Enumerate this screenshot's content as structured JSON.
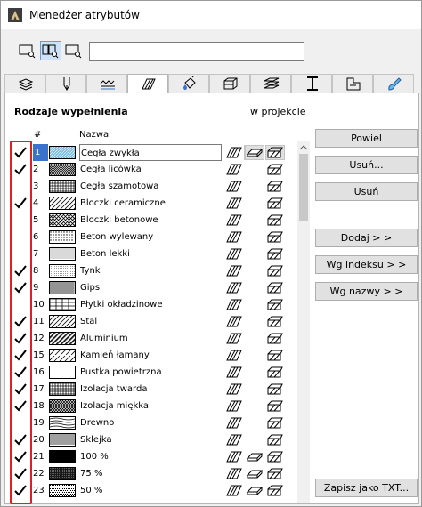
{
  "window": {
    "title": "Menedżer atrybutów"
  },
  "toolbar": {
    "buttons": [
      {
        "name": "view-list-icon"
      },
      {
        "name": "view-details-icon"
      },
      {
        "name": "view-search-icon"
      }
    ],
    "search": {
      "value": "",
      "placeholder": ""
    }
  },
  "tabs": [
    {
      "name": "tab-layers",
      "icon": "layers-icon"
    },
    {
      "name": "tab-pens",
      "icon": "pen-icon"
    },
    {
      "name": "tab-line-types",
      "icon": "line-types-icon"
    },
    {
      "name": "tab-fills",
      "icon": "fill-icon",
      "selected": true
    },
    {
      "name": "tab-surfaces",
      "icon": "paint-bucket-icon"
    },
    {
      "name": "tab-building-materials",
      "icon": "building-material-icon"
    },
    {
      "name": "tab-composites",
      "icon": "composite-icon"
    },
    {
      "name": "tab-profiles",
      "icon": "profile-icon"
    },
    {
      "name": "tab-zones",
      "icon": "zone-icon"
    },
    {
      "name": "tab-renovation",
      "icon": "brush-icon"
    }
  ],
  "section": {
    "title": "Rodzaje wypełnienia",
    "project_label": "w projekcie"
  },
  "table": {
    "columns": {
      "num": "#",
      "name": "Nazwa"
    },
    "rows": [
      {
        "checked": true,
        "num": "1",
        "name": "Cegła zwykła",
        "pattern": "diag-cyan",
        "icons": [
          true,
          true,
          true
        ],
        "selected": true
      },
      {
        "checked": true,
        "num": "2",
        "name": "Cegła licówka",
        "pattern": "diag-dense",
        "icons": [
          true,
          false,
          true
        ]
      },
      {
        "checked": false,
        "num": "3",
        "name": "Cegła szamotowa",
        "pattern": "grid",
        "icons": [
          true,
          false,
          true
        ]
      },
      {
        "checked": true,
        "num": "4",
        "name": "Bloczki ceramiczne",
        "pattern": "diag-sparse",
        "icons": [
          true,
          false,
          true
        ]
      },
      {
        "checked": false,
        "num": "5",
        "name": "Bloczki betonowe",
        "pattern": "crosshatch",
        "icons": [
          true,
          false,
          true
        ]
      },
      {
        "checked": false,
        "num": "6",
        "name": "Beton wylewany",
        "pattern": "dots",
        "icons": [
          true,
          false,
          true
        ]
      },
      {
        "checked": false,
        "num": "7",
        "name": "Beton lekki",
        "pattern": "dots-fine",
        "icons": [
          true,
          false,
          true
        ]
      },
      {
        "checked": true,
        "num": "8",
        "name": "Tynk",
        "pattern": "stipple",
        "icons": [
          true,
          false,
          true
        ]
      },
      {
        "checked": true,
        "num": "9",
        "name": "Gips",
        "pattern": "grid-fine",
        "icons": [
          true,
          false,
          true
        ]
      },
      {
        "checked": false,
        "num": "10",
        "name": "Płytki okładzinowe",
        "pattern": "tiles",
        "icons": [
          true,
          false,
          true
        ]
      },
      {
        "checked": true,
        "num": "11",
        "name": "Stal",
        "pattern": "diag-sparse",
        "icons": [
          true,
          false,
          true
        ]
      },
      {
        "checked": true,
        "num": "12",
        "name": "Aluminium",
        "pattern": "diag-double",
        "icons": [
          true,
          false,
          true
        ]
      },
      {
        "checked": true,
        "num": "15",
        "name": "Kamień łamany",
        "pattern": "broken",
        "icons": [
          true,
          false,
          true
        ]
      },
      {
        "checked": true,
        "num": "16",
        "name": "Pustka powietrzna",
        "pattern": "empty",
        "icons": [
          true,
          false,
          true
        ]
      },
      {
        "checked": true,
        "num": "17",
        "name": "Izolacja twarda",
        "pattern": "grid",
        "icons": [
          true,
          false,
          true
        ]
      },
      {
        "checked": true,
        "num": "18",
        "name": "Izolacja miękka",
        "pattern": "insulation",
        "icons": [
          true,
          false,
          true
        ]
      },
      {
        "checked": false,
        "num": "19",
        "name": "Drewno",
        "pattern": "wood",
        "icons": [
          true,
          false,
          true
        ]
      },
      {
        "checked": true,
        "num": "20",
        "name": "Sklejka",
        "pattern": "lines-h",
        "icons": [
          true,
          false,
          true
        ]
      },
      {
        "checked": true,
        "num": "21",
        "name": "100 %",
        "pattern": "solid",
        "icons": [
          true,
          true,
          true
        ]
      },
      {
        "checked": true,
        "num": "22",
        "name": "75 %",
        "pattern": "dark",
        "icons": [
          true,
          true,
          true
        ]
      },
      {
        "checked": true,
        "num": "23",
        "name": "50 %",
        "pattern": "mid",
        "icons": [
          true,
          true,
          true
        ]
      }
    ]
  },
  "buttons": {
    "duplicate": "Powiel",
    "delete": "Usuń...",
    "remove": "Usuń",
    "add": "Dodaj > >",
    "by_index": "Wg indeksu > >",
    "by_name": "Wg nazwy > >",
    "save_txt": "Zapisz jako TXT..."
  },
  "colors": {
    "accent": "#3a72cc",
    "highlight_box": "#e02020",
    "pattern_cyan": "#6fb6e0"
  }
}
